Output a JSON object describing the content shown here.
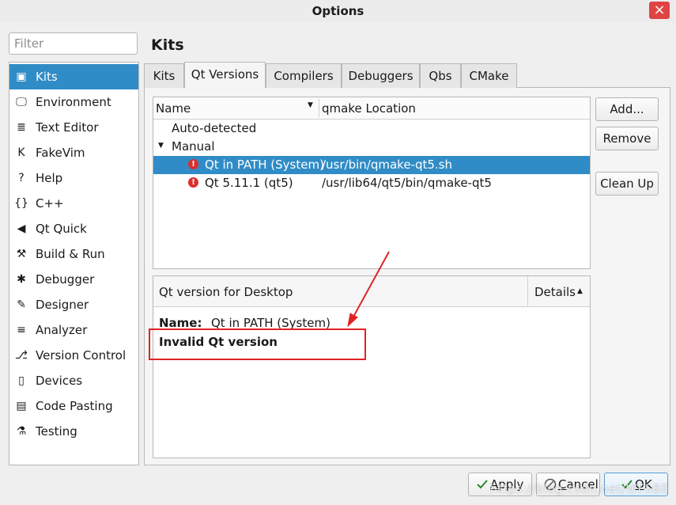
{
  "window": {
    "title": "Options",
    "close_glyph": "×"
  },
  "filter": {
    "placeholder": "Filter",
    "value": ""
  },
  "sidebar": {
    "selected_color": "#308cc6",
    "items": [
      {
        "label": "Kits",
        "icon": "kits-icon",
        "glyph": "▣",
        "selected": true
      },
      {
        "label": "Environment",
        "icon": "monitor-icon",
        "glyph": "🖵",
        "selected": false
      },
      {
        "label": "Text Editor",
        "icon": "text-editor-icon",
        "glyph": "≣",
        "selected": false
      },
      {
        "label": "FakeVim",
        "icon": "fakevim-icon",
        "glyph": "K",
        "selected": false
      },
      {
        "label": "Help",
        "icon": "help-icon",
        "glyph": "?",
        "selected": false
      },
      {
        "label": "C++",
        "icon": "braces-icon",
        "glyph": "{}",
        "selected": false
      },
      {
        "label": "Qt Quick",
        "icon": "qt-quick-icon",
        "glyph": "◀",
        "selected": false
      },
      {
        "label": "Build & Run",
        "icon": "hammer-icon",
        "glyph": "⚒",
        "selected": false
      },
      {
        "label": "Debugger",
        "icon": "bug-icon",
        "glyph": "✱",
        "selected": false
      },
      {
        "label": "Designer",
        "icon": "pencil-icon",
        "glyph": "✎",
        "selected": false
      },
      {
        "label": "Analyzer",
        "icon": "analyzer-icon",
        "glyph": "≡",
        "selected": false
      },
      {
        "label": "Version Control",
        "icon": "version-control-icon",
        "glyph": "⎇",
        "selected": false
      },
      {
        "label": "Devices",
        "icon": "devices-icon",
        "glyph": "▯",
        "selected": false
      },
      {
        "label": "Code Pasting",
        "icon": "clipboard-icon",
        "glyph": "▤",
        "selected": false
      },
      {
        "label": "Testing",
        "icon": "flask-icon",
        "glyph": "⚗",
        "selected": false
      }
    ]
  },
  "page": {
    "title": "Kits"
  },
  "tabs": [
    {
      "label": "Kits",
      "active": false
    },
    {
      "label": "Qt Versions",
      "active": true
    },
    {
      "label": "Compilers",
      "active": false
    },
    {
      "label": "Debuggers",
      "active": false
    },
    {
      "label": "Qbs",
      "active": false
    },
    {
      "label": "CMake",
      "active": false
    }
  ],
  "tree": {
    "columns": [
      "Name",
      "qmake Location"
    ],
    "sort_glyph": "▼",
    "expand_glyph": "▼",
    "rows": [
      {
        "name": "Auto-detected",
        "location": "",
        "error": false,
        "selected": false,
        "expandable": false
      },
      {
        "name": "Manual",
        "location": "",
        "error": false,
        "selected": false,
        "expandable": true
      },
      {
        "name": "Qt  in PATH (System)",
        "location": "/usr/bin/qmake-qt5.sh",
        "error": true,
        "selected": true,
        "expandable": false
      },
      {
        "name": "Qt 5.11.1 (qt5)",
        "location": "/usr/lib64/qt5/bin/qmake-qt5",
        "error": true,
        "selected": false,
        "expandable": false
      }
    ]
  },
  "buttons": {
    "add": "Add...",
    "remove": "Remove",
    "cleanup": "Clean Up"
  },
  "details": {
    "header": "Qt version  for Desktop",
    "toggle_label": "Details",
    "toggle_caret": "▲",
    "name_label": "Name:",
    "name_value": "Qt in PATH (System)",
    "status": "Invalid Qt version"
  },
  "annotation": {
    "color": "#e02424"
  },
  "dialog_buttons": {
    "apply": {
      "label": "Apply",
      "mnemonic": "A",
      "rest": "pply"
    },
    "cancel": {
      "label": "Cancel",
      "mnemonic": "C",
      "rest": "ancel"
    },
    "ok": {
      "label": "OK",
      "mnemonic": "O",
      "rest": "K"
    }
  },
  "watermark": "https://blog.csdn.net/WF5BE"
}
